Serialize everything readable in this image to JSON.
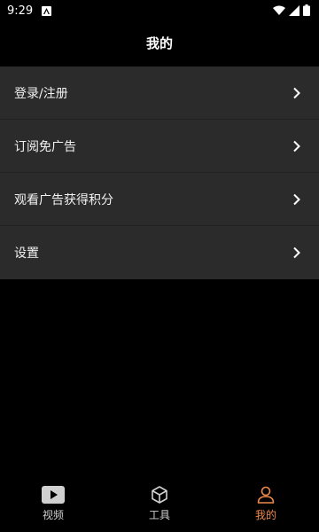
{
  "status": {
    "time": "9:29"
  },
  "page": {
    "title": "我的"
  },
  "menu": {
    "items": [
      {
        "label": "登录/注册"
      },
      {
        "label": "订阅免广告"
      },
      {
        "label": "观看广告获得积分"
      },
      {
        "label": "设置"
      }
    ]
  },
  "tabs": [
    {
      "label": "视频",
      "icon": "video-play-icon"
    },
    {
      "label": "工具",
      "icon": "cube-icon"
    },
    {
      "label": "我的",
      "icon": "user-icon"
    }
  ],
  "colors": {
    "active_tab": "#f0894a",
    "menu_bg": "#2b2b2b",
    "background": "#000000"
  }
}
